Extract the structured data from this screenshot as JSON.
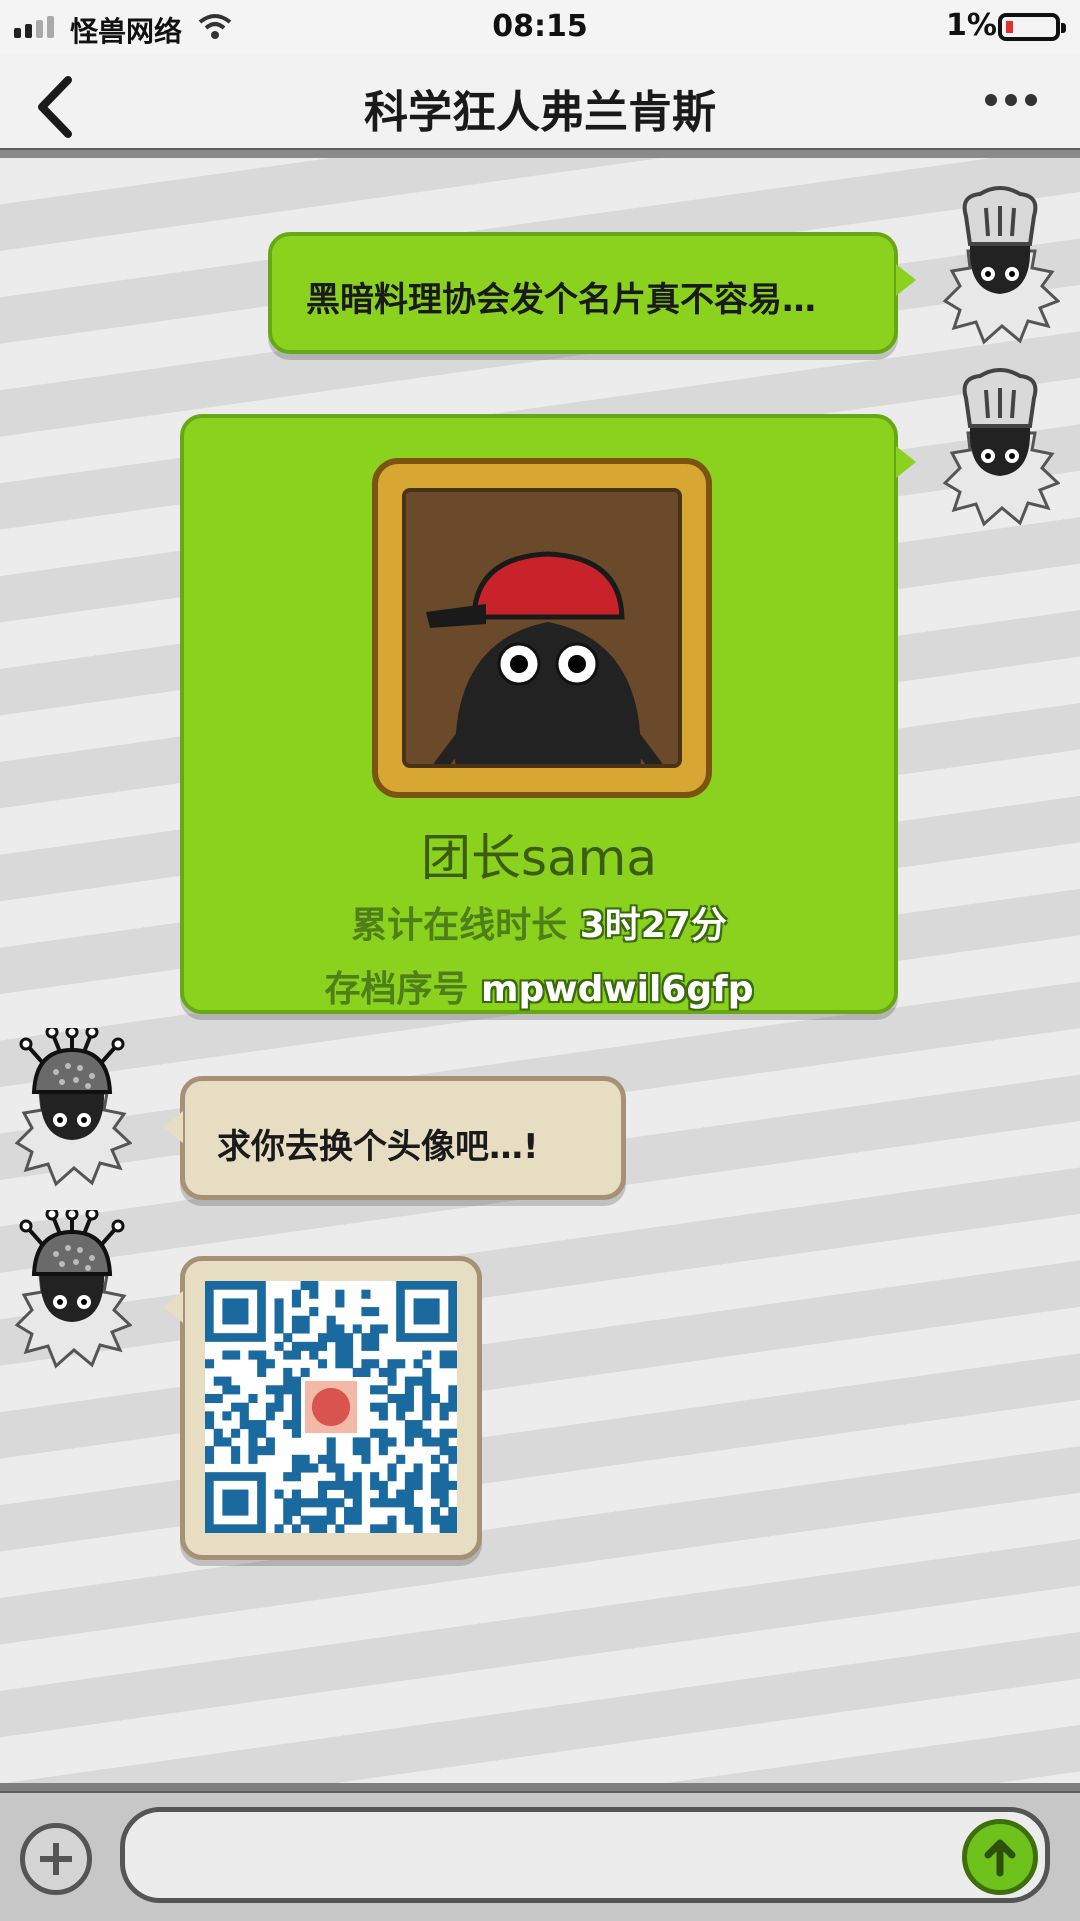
{
  "status_bar": {
    "carrier": "怪兽网络",
    "time": "08:15",
    "battery_pct": "1%"
  },
  "nav": {
    "title": "科学狂人弗兰肯斯"
  },
  "messages": {
    "m1_text": "黑暗料理协会发个名片真不容易…",
    "card": {
      "name": "团长sama",
      "online_label": "累计在线时长",
      "online_value": "3时27分",
      "archive_label": "存档序号",
      "archive_value": "mpwdwil6gfp"
    },
    "m3_text": "求你去换个头像吧…!"
  },
  "input": {
    "value": "",
    "placeholder": ""
  },
  "colors": {
    "my_bubble": "#8bd21f",
    "their_bubble": "#e6ddc3",
    "qr": "#1a6aa0"
  },
  "icons": [
    "back-arrow-icon",
    "more-dots-icon",
    "plus-icon",
    "send-arrow-icon",
    "chef-hat-avatar",
    "colander-avatar",
    "red-cap-avatar"
  ]
}
